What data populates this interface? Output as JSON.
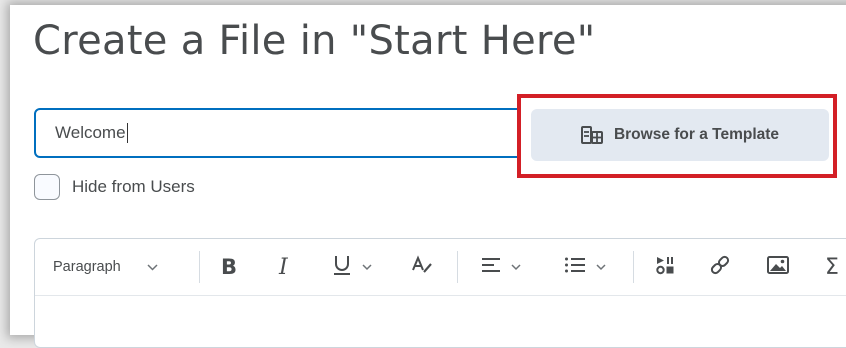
{
  "page": {
    "title": "Create a File in \"Start Here\""
  },
  "form": {
    "title_value": "Welcome",
    "browse_button_label": "Browse for a Template",
    "hide_checkbox_label": "Hide from Users",
    "hide_checked": false
  },
  "toolbar": {
    "paragraph_label": "Paragraph",
    "chevron": "⌄",
    "tools": [
      "paragraph-format-dropdown",
      "bold",
      "italic",
      "underline-dropdown",
      "format-painter",
      "align-dropdown",
      "list-dropdown",
      "insert-media-stuff",
      "insert-link",
      "insert-image",
      "equation"
    ]
  },
  "colors": {
    "highlight": "#d31f26",
    "input_focus": "#006fbf",
    "button_bg": "#e3e9f1",
    "text": "#494c4e"
  }
}
